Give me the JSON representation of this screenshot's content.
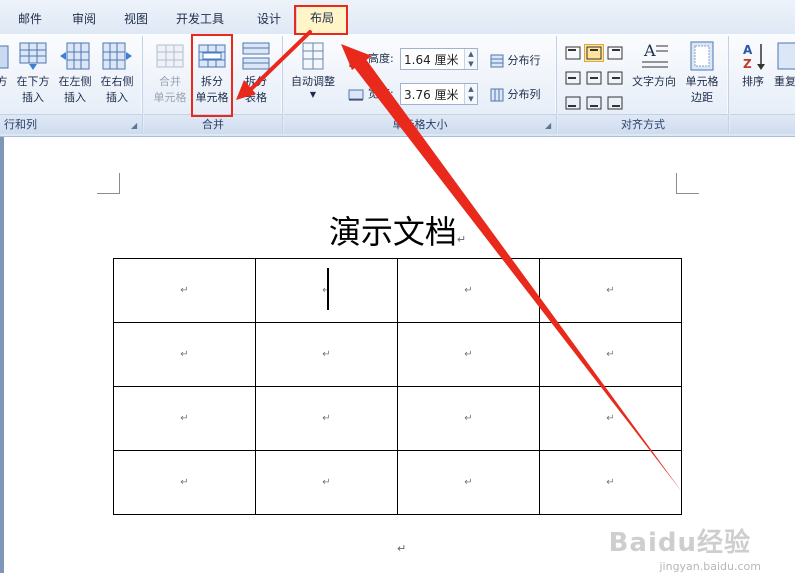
{
  "tabs": [
    {
      "id": "mail",
      "label": "邮件"
    },
    {
      "id": "review",
      "label": "审阅"
    },
    {
      "id": "view",
      "label": "视图"
    },
    {
      "id": "developer",
      "label": "开发工具"
    },
    {
      "id": "design",
      "label": "设计"
    },
    {
      "id": "layout",
      "label": "布局"
    }
  ],
  "ribbon": {
    "rows_cols": {
      "label": "行和列",
      "insert_above_partial": "方",
      "insert_below": "在下方插入",
      "insert_left": "在左侧插入",
      "insert_right": "在右侧插入",
      "insert_below_l1": "在下方",
      "insert_below_l2": "插入",
      "insert_left_l1": "在左侧",
      "insert_left_l2": "插入",
      "insert_right_l1": "在右侧",
      "insert_right_l2": "插入"
    },
    "merge": {
      "label": "合并",
      "merge_l1": "合并",
      "merge_l2": "单元格",
      "split_cells_l1": "拆分",
      "split_cells_l2": "单元格",
      "split_table_l1": "拆分",
      "split_table_l2": "表格"
    },
    "cell_size": {
      "label": "单元格大小",
      "autofit": "自动调整",
      "height_label": "高度:",
      "height_value": "1.64 厘米",
      "width_label": "宽度:",
      "width_value": "3.76 厘米",
      "distribute_rows": "分布行",
      "distribute_cols": "分布列"
    },
    "alignment": {
      "label": "对齐方式",
      "text_direction": "文字方向",
      "cell_margins_l1": "单元格",
      "cell_margins_l2": "边距"
    },
    "data": {
      "sort": "排序",
      "repeat_partial": "重复"
    }
  },
  "document": {
    "title": "演示文档",
    "paragraph_mark": "↵",
    "table": {
      "rows": 4,
      "cols": 4
    }
  },
  "watermark": {
    "brand": "Baidu经验",
    "url": "jingyan.baidu.com"
  },
  "colors": {
    "highlight": "#e8291c",
    "active_tab": "#fff5c9",
    "ribbon_label": "#2a3f66"
  }
}
